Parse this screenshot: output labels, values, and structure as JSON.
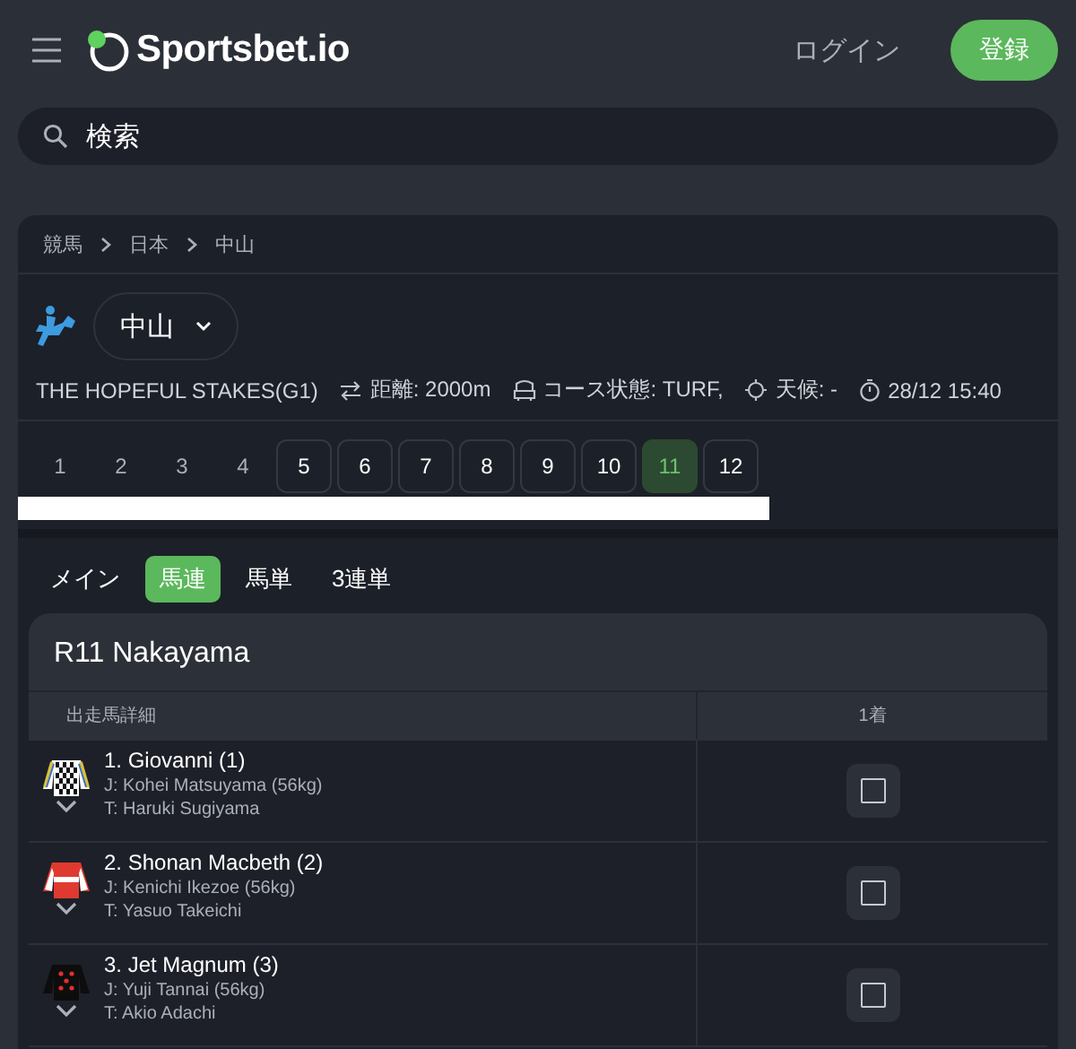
{
  "header": {
    "logo": "Sportsbet.io",
    "login": "ログイン",
    "register": "登録"
  },
  "search": {
    "placeholder": "検索"
  },
  "breadcrumb": [
    "競馬",
    "日本",
    "中山"
  ],
  "venue": {
    "label": "中山"
  },
  "race_info": {
    "name": "THE HOPEFUL STAKES(G1)",
    "distance": "距離: 2000m",
    "course": "コース状態: TURF,",
    "weather": "天候: -",
    "time": "28/12 15:40"
  },
  "races": [
    {
      "label": "1",
      "disabled": true,
      "selected": false
    },
    {
      "label": "2",
      "disabled": true,
      "selected": false
    },
    {
      "label": "3",
      "disabled": true,
      "selected": false
    },
    {
      "label": "4",
      "disabled": true,
      "selected": false
    },
    {
      "label": "5",
      "disabled": false,
      "selected": false
    },
    {
      "label": "6",
      "disabled": false,
      "selected": false
    },
    {
      "label": "7",
      "disabled": false,
      "selected": false
    },
    {
      "label": "8",
      "disabled": false,
      "selected": false
    },
    {
      "label": "9",
      "disabled": false,
      "selected": false
    },
    {
      "label": "10",
      "disabled": false,
      "selected": false
    },
    {
      "label": "11",
      "disabled": false,
      "selected": true
    },
    {
      "label": "12",
      "disabled": false,
      "selected": false
    }
  ],
  "tabs": [
    {
      "label": "メイン",
      "selected": false
    },
    {
      "label": "馬連",
      "selected": true
    },
    {
      "label": "馬単",
      "selected": false
    },
    {
      "label": "3連単",
      "selected": false
    }
  ],
  "card": {
    "title": "R11 Nakayama",
    "columns": [
      "出走馬詳細",
      "1着"
    ],
    "runners": [
      {
        "name": "1. Giovanni (1)",
        "jockey": "J: Kohei Matsuyama (56kg)",
        "trainer": "T: Haruki Sugiyama",
        "checked": false
      },
      {
        "name": "2. Shonan Macbeth (2)",
        "jockey": "J: Kenichi Ikezoe (56kg)",
        "trainer": "T: Yasuo Takeichi",
        "checked": false
      },
      {
        "name": "3. Jet Magnum (3)",
        "jockey": "J: Yuji Tannai (56kg)",
        "trainer": "T: Akio Adachi",
        "checked": false
      }
    ]
  }
}
